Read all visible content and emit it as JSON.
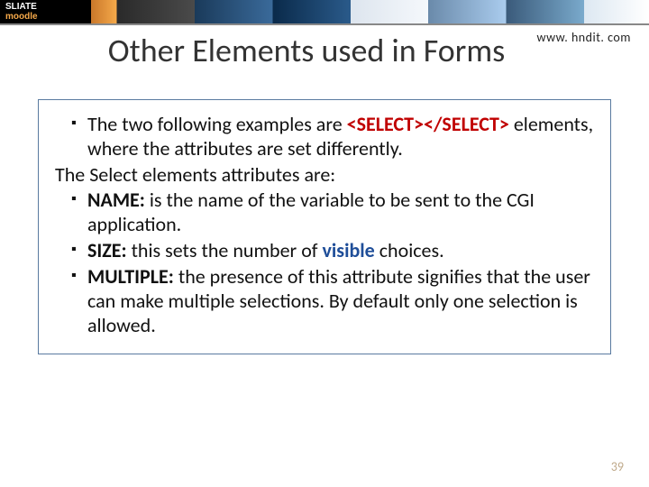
{
  "banner": {
    "logo_prefix": "SLIATE",
    "logo_word": "moodle"
  },
  "url": "www. hndit. com",
  "title": "Other Elements used in Forms",
  "body": {
    "b1_a": "The two following examples are ",
    "b1_code": "<SELECT></SELECT>",
    "b1_b": " elements, where the attributes are set differently.",
    "line2": "The Select elements attributes are:",
    "b3_label": "NAME:",
    "b3_text": " is the name of the variable to be sent to the CGI application.",
    "b4_label": "SIZE:",
    "b4_text_a": " this sets the number of ",
    "b4_visible": "visible",
    "b4_text_b": " choices.",
    "b5_label": "MULTIPLE:",
    "b5_text": " the presence of this attribute signifies that the user can make multiple selections. By default only one selection is allowed."
  },
  "slide_number": "39"
}
